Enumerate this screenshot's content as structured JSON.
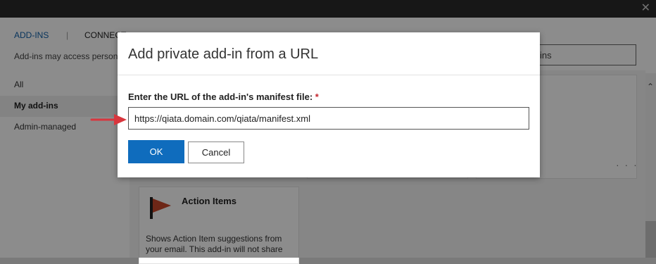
{
  "window": {
    "close_glyph": "✕"
  },
  "nav": {
    "tab_addins": "ADD-INS",
    "tab_separator": "|",
    "tab_connect": "CONNECT"
  },
  "hint": "Add-ins may access personal",
  "search": {
    "text": "ins"
  },
  "sidebar": {
    "items": [
      {
        "label": "All"
      },
      {
        "label": "My add-ins"
      },
      {
        "label": "Admin-managed"
      }
    ]
  },
  "cards": {
    "action_items": {
      "title": "Action Items",
      "description": "Shows Action Item suggestions from your email. This add-in will not share"
    },
    "more_glyph": "· · ·"
  },
  "dialog": {
    "title": "Add private add-in from a URL",
    "field_label": "Enter the URL of the add-in's manifest file:",
    "required_mark": "*",
    "url_value": "https://qiata.domain.com/qiata/manifest.xml",
    "ok_label": "OK",
    "cancel_label": "Cancel"
  },
  "colors": {
    "accent": "#0f6cbd",
    "arrow": "#d9363e",
    "flag": "#c8472b"
  },
  "icons": [
    "close-icon",
    "flag-icon",
    "red-arrow-icon",
    "scroll-up-icon"
  ]
}
